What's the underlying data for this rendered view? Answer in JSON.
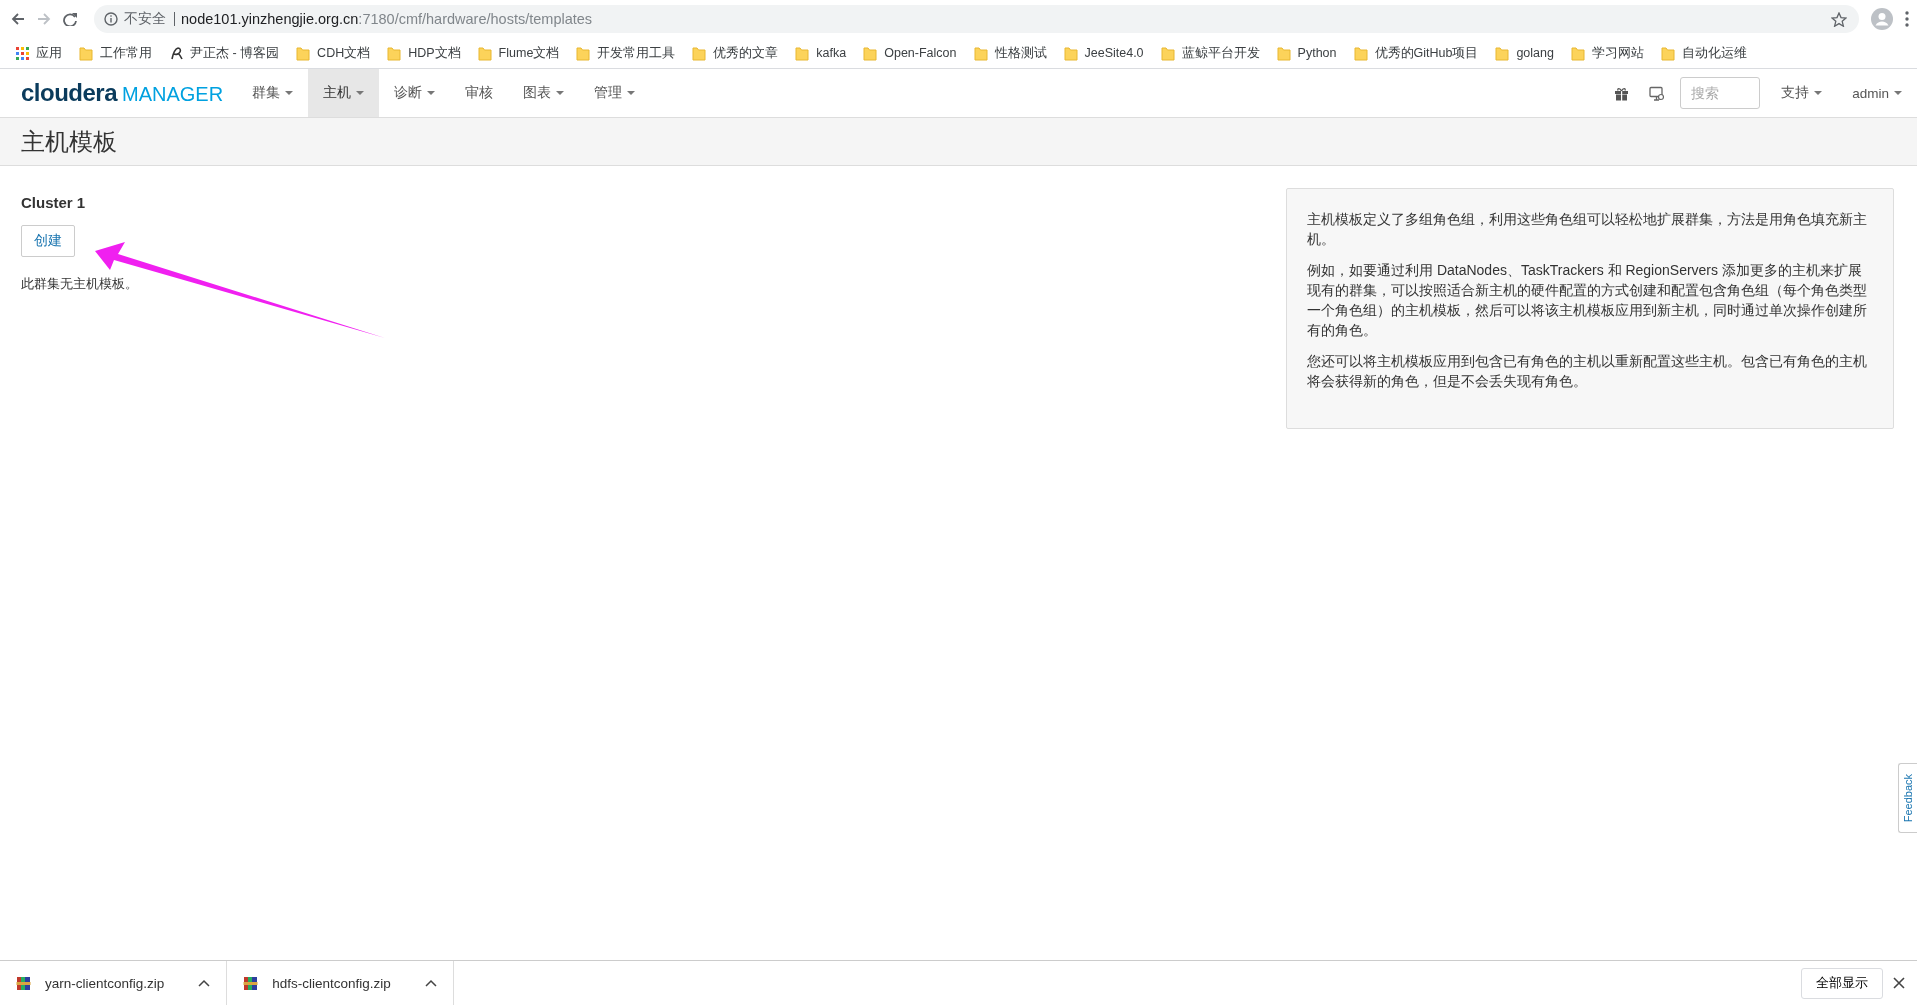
{
  "browser": {
    "security_label": "不安全",
    "url_host": "node101.yinzhengjie.org.cn",
    "url_path": ":7180/cmf/hardware/hosts/templates",
    "bookmarks": [
      {
        "label": "应用",
        "kind": "apps"
      },
      {
        "label": "工作常用",
        "kind": "folder"
      },
      {
        "label": "尹正杰 - 博客园",
        "kind": "site"
      },
      {
        "label": "CDH文档",
        "kind": "folder"
      },
      {
        "label": "HDP文档",
        "kind": "folder"
      },
      {
        "label": "Flume文档",
        "kind": "folder"
      },
      {
        "label": "开发常用工具",
        "kind": "folder"
      },
      {
        "label": "优秀的文章",
        "kind": "folder"
      },
      {
        "label": "kafka",
        "kind": "folder"
      },
      {
        "label": "Open-Falcon",
        "kind": "folder"
      },
      {
        "label": "性格测试",
        "kind": "folder"
      },
      {
        "label": "JeeSite4.0",
        "kind": "folder"
      },
      {
        "label": "蓝鲸平台开发",
        "kind": "folder"
      },
      {
        "label": "Python",
        "kind": "folder"
      },
      {
        "label": "优秀的GitHub项目",
        "kind": "folder"
      },
      {
        "label": "golang",
        "kind": "folder"
      },
      {
        "label": "学习网站",
        "kind": "folder"
      },
      {
        "label": "自动化运维",
        "kind": "folder"
      }
    ]
  },
  "navbar": {
    "logo": {
      "brand": "cloudera",
      "product": "MANAGER"
    },
    "menu": [
      {
        "label": "群集",
        "dropdown": true,
        "selected": false
      },
      {
        "label": "主机",
        "dropdown": true,
        "selected": true
      },
      {
        "label": "诊断",
        "dropdown": true,
        "selected": false
      },
      {
        "label": "审核",
        "dropdown": false,
        "selected": false
      },
      {
        "label": "图表",
        "dropdown": true,
        "selected": false
      },
      {
        "label": "管理",
        "dropdown": true,
        "selected": false
      }
    ],
    "search": {
      "placeholder": "搜索"
    },
    "right_menu": [
      {
        "label": "支持",
        "dropdown": true
      },
      {
        "label": "admin",
        "dropdown": true
      }
    ]
  },
  "page_title": "主机模板",
  "cluster": {
    "name": "Cluster 1",
    "create_button": "创建",
    "empty_message": "此群集无主机模板。"
  },
  "info_panel": {
    "paragraphs": [
      "主机模板定义了多组角色组，利用这些角色组可以轻松地扩展群集，方法是用角色填充新主机。",
      "例如，如要通过利用 DataNodes、TaskTrackers 和 RegionServers 添加更多的主机来扩展现有的群集，可以按照适合新主机的硬件配置的方式创建和配置包含角色组（每个角色类型一个角色组）的主机模板，然后可以将该主机模板应用到新主机，同时通过单次操作创建所有的角色。",
      "您还可以将主机模板应用到包含已有角色的主机以重新配置这些主机。包含已有角色的主机将会获得新的角色，但是不会丢失现有角色。"
    ]
  },
  "feedback_tab": "Feedback",
  "downloads": {
    "items": [
      {
        "filename": "yarn-clientconfig.zip"
      },
      {
        "filename": "hdfs-clientconfig.zip"
      }
    ],
    "show_all": "全部显示"
  }
}
